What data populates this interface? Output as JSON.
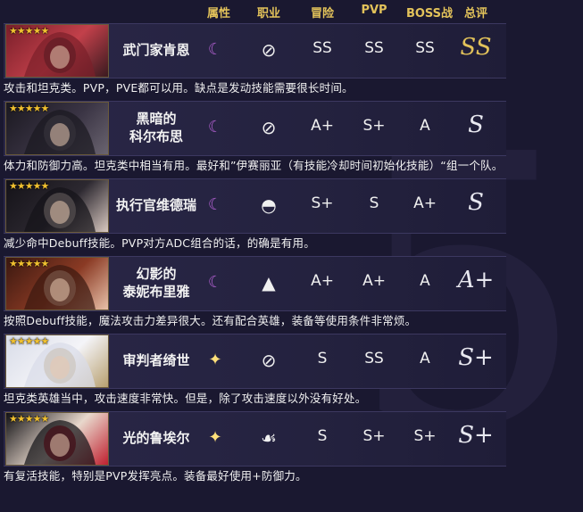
{
  "header": {
    "attribute": "属性",
    "class": "职业",
    "adventure": "冒险",
    "pvp": "PVP",
    "boss": "BOSS战",
    "overall": "总评"
  },
  "background_mark": "5",
  "heroes": [
    {
      "stars": "★★★★★",
      "name": "武门家肯恩",
      "attribute_icon": "moon-icon",
      "attribute_glyph": "☾",
      "class_icon": "crossed-sword-icon",
      "class_glyph": "⊘",
      "adventure": "SS",
      "pvp": "SS",
      "boss": "SS",
      "overall": "SS",
      "overall_color": "#e2c25a",
      "description": "攻击和坦克类。PVP，PVE都可以用。缺点是发动技能需要很长时间。"
    },
    {
      "stars": "★★★★★",
      "name": "黑暗的\n科尔布思",
      "attribute_icon": "moon-icon",
      "attribute_glyph": "☾",
      "class_icon": "crossed-sword-icon",
      "class_glyph": "⊘",
      "adventure": "A+",
      "pvp": "S+",
      "boss": "A",
      "overall": "S",
      "overall_color": "#e8e8f0",
      "description": "体力和防御力高。坦克类中相当有用。最好和”伊赛丽亚（有技能冷却时间初始化技能）“组一个队。"
    },
    {
      "stars": "★★★★★",
      "name": "执行官维德瑞",
      "attribute_icon": "moon-icon",
      "attribute_glyph": "☾",
      "class_icon": "hood-icon",
      "class_glyph": "◓",
      "adventure": "S+",
      "pvp": "S",
      "boss": "A+",
      "overall": "S",
      "overall_color": "#e8e8f0",
      "description": "减少命中Debuff技能。PVP对方ADC组合的话，的确是有用。"
    },
    {
      "stars": "★★★★★",
      "name": "幻影的\n泰妮布里雅",
      "attribute_icon": "moon-icon",
      "attribute_glyph": "☾",
      "class_icon": "wizard-hat-icon",
      "class_glyph": "▲",
      "adventure": "A+",
      "pvp": "A+",
      "boss": "A",
      "overall": "A+",
      "overall_color": "#e8e8f0",
      "description": "按照Debuff技能，魔法攻击力差异很大。还有配合英雄，装备等使用条件非常烦。"
    },
    {
      "stars": "★★★★★",
      "name": "审判者绮世",
      "attribute_icon": "sparkle-icon",
      "attribute_glyph": "✦",
      "class_icon": "crossed-sword-icon",
      "class_glyph": "⊘",
      "adventure": "S",
      "pvp": "SS",
      "boss": "A",
      "overall": "S+",
      "overall_color": "#e8e8f0",
      "description": "坦克类英雄当中，攻击速度非常快。但是，除了攻击速度以外没有好处。"
    },
    {
      "stars": "★★★★★",
      "name": "光的鲁埃尔",
      "attribute_icon": "sparkle-icon",
      "attribute_glyph": "✦",
      "class_icon": "heal-hand-icon",
      "class_glyph": "☙",
      "adventure": "S",
      "pvp": "S+",
      "boss": "S+",
      "overall": "S+",
      "overall_color": "#e8e8f0",
      "description": "有复活技能，特别是PVP发挥亮点。装备最好使用+防御力。"
    }
  ],
  "portrait_palettes": [
    [
      "#7a1f2a",
      "#c2404a",
      "#3a1a20"
    ],
    [
      "#1a1820",
      "#3a3444",
      "#6a6470"
    ],
    [
      "#141218",
      "#2c2830",
      "#d8c8c0"
    ],
    [
      "#3a1810",
      "#8a3a24",
      "#e8c0a8"
    ],
    [
      "#d8dce8",
      "#f4f4f8",
      "#b8a070"
    ],
    [
      "#101014",
      "#e8d8cc",
      "#c02030"
    ]
  ]
}
